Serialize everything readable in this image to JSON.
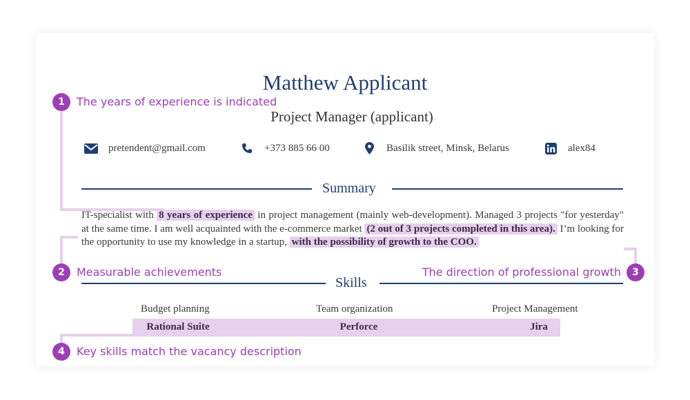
{
  "resume": {
    "name": "Matthew Applicant",
    "role": "Project Manager (applicant)",
    "contacts": [
      {
        "icon": "envelope-icon",
        "value": "pretendent@gmail.com"
      },
      {
        "icon": "phone-icon",
        "value": "+373 885 66 00"
      },
      {
        "icon": "map-pin-icon",
        "value": "Basilik street, Minsk, Belarus"
      },
      {
        "icon": "linkedin-icon",
        "value": "alex84"
      }
    ],
    "summary": {
      "title": "Summary",
      "p1": "IT-specialist with ",
      "h1": "8 years of experience",
      "p2": " in project management (mainly web-development). Managed 3 projects \"for yesterday\" at the same time. I am well acquainted with the e-commerce market ",
      "h2": "(2 out of 3 projects completed in this area).",
      "p3": " I’m looking for the opportunity to use my knowledge in a startup, ",
      "h3": "with the possibility of growth to the COO."
    },
    "skills": {
      "title": "Skills",
      "soft": [
        "Budget planning",
        "Team organization",
        "Project Management"
      ],
      "tools": [
        "Rational Suite",
        "Perforce",
        "Jira"
      ]
    }
  },
  "annotations": [
    {
      "number": "1",
      "text": "The years of experience is indicated"
    },
    {
      "number": "2",
      "text": "Measurable achievements"
    },
    {
      "number": "3",
      "text": "The direction of professional growth"
    },
    {
      "number": "4",
      "text": "Key skills match the vacancy description"
    }
  ],
  "colors": {
    "accent_navy": "#1f3f73",
    "annotation_purple": "#9c3fb5",
    "highlight_lilac": "#e6d0ec"
  }
}
